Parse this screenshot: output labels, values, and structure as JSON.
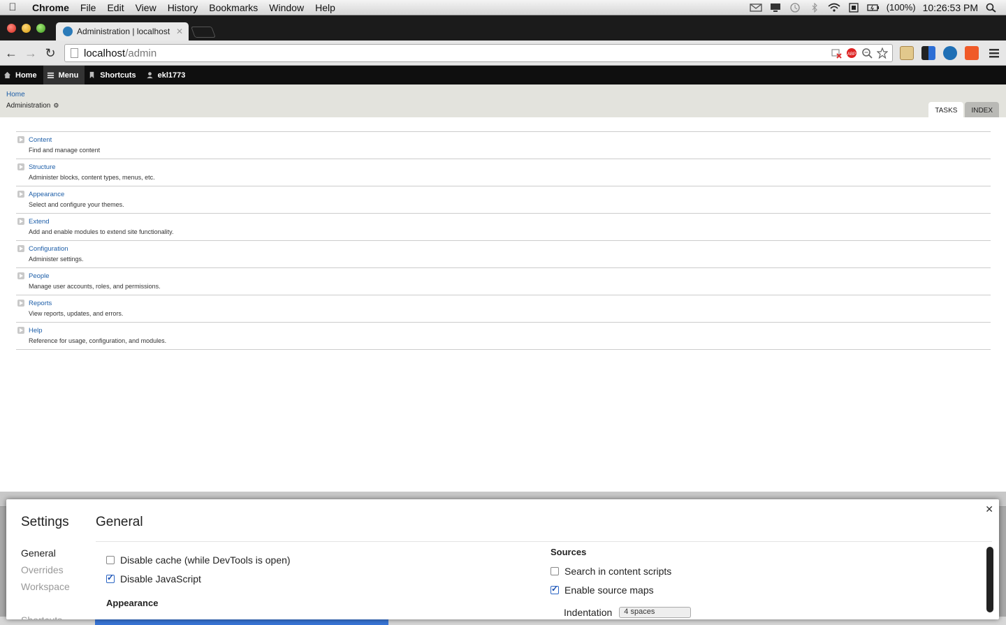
{
  "menubar": {
    "app": "Chrome",
    "items": [
      "File",
      "Edit",
      "View",
      "History",
      "Bookmarks",
      "Window",
      "Help"
    ],
    "battery": "(100%)",
    "clock": "10:26:53 PM"
  },
  "browser": {
    "tab_title": "Administration | localhost",
    "url_host": "localhost",
    "url_path": "/admin"
  },
  "drupal_toolbar": {
    "home": "Home",
    "menu": "Menu",
    "shortcuts": "Shortcuts",
    "user": "ekl1773"
  },
  "header": {
    "breadcrumb": "Home",
    "title": "Administration",
    "tabs": [
      "TASKS",
      "INDEX"
    ]
  },
  "admin_items": [
    {
      "title": "Content",
      "desc": "Find and manage content"
    },
    {
      "title": "Structure",
      "desc": "Administer blocks, content types, menus, etc."
    },
    {
      "title": "Appearance",
      "desc": "Select and configure your themes."
    },
    {
      "title": "Extend",
      "desc": "Add and enable modules to extend site functionality."
    },
    {
      "title": "Configuration",
      "desc": "Administer settings."
    },
    {
      "title": "People",
      "desc": "Manage user accounts, roles, and permissions."
    },
    {
      "title": "Reports",
      "desc": "View reports, updates, and errors."
    },
    {
      "title": "Help",
      "desc": "Reference for usage, configuration, and modules."
    }
  ],
  "settings": {
    "title": "Settings",
    "section_title": "General",
    "nav": [
      "General",
      "Overrides",
      "Workspace",
      "Shortcuts"
    ],
    "left_options": [
      {
        "label": "Disable cache (while DevTools is open)",
        "checked": false
      },
      {
        "label": "Disable JavaScript",
        "checked": true
      }
    ],
    "appearance_heading": "Appearance",
    "sources_heading": "Sources",
    "right_options": [
      {
        "label": "Search in content scripts",
        "checked": false
      },
      {
        "label": "Enable source maps",
        "checked": true
      }
    ],
    "indentation_label": "Indentation",
    "indentation_value": "4 spaces"
  }
}
